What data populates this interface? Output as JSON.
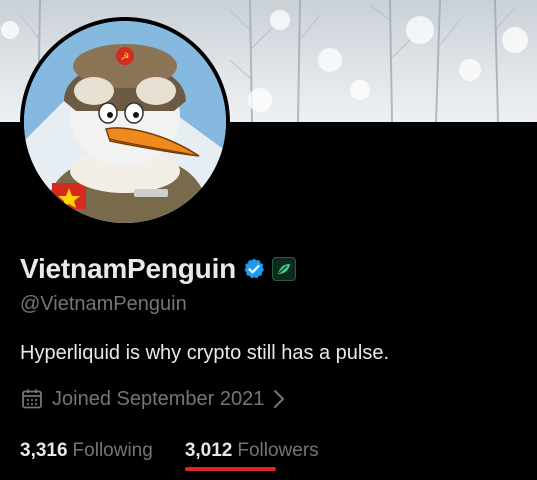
{
  "profile": {
    "display_name": "VietnamPenguin",
    "handle": "@VietnamPenguin",
    "bio": "Hyperliquid is why crypto still has a pulse.",
    "joined": "Joined September 2021",
    "verified_color": "#1d9bf0",
    "affiliate_badge_icon": "leaf-icon"
  },
  "stats": {
    "following_count": "3,316",
    "following_label": "Following",
    "followers_count": "3,012",
    "followers_label": "Followers"
  },
  "colors": {
    "background": "#000000",
    "text_primary": "#e7e9ea",
    "text_secondary": "#71767b",
    "highlight_underline": "#e0241f"
  }
}
